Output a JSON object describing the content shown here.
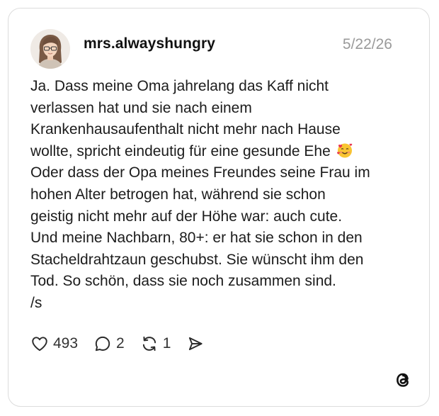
{
  "post": {
    "username": "mrs.alwayshungry",
    "date": "5/22/26",
    "text_before_emoji": "Ja. Dass meine Oma jahrelang das Kaff nicht\nverlassen hat und sie nach einem\nKrankenhausaufenthalt nicht mehr nach Hause\nwollte, spricht eindeutig für eine gesunde Ehe",
    "text_after_emoji": "\nOder dass der Opa meines Freundes seine Frau im\nhohen Alter betrogen hat, während sie schon\ngeistig nicht mehr auf der Höhe war: auch cute.\nUnd meine Nachbarn, 80+: er hat sie schon in den\nStacheldrahtzaun geschubst. Sie wünscht ihm den\nTod. So schön, dass sie noch zusammen sind.\n/s",
    "emoji": "smiling-face-with-hearts"
  },
  "actions": {
    "likes": "493",
    "replies": "2",
    "reposts": "1"
  },
  "icons": {
    "like": "heart-icon",
    "reply": "speech-bubble-icon",
    "repost": "repost-icon",
    "share": "send-icon",
    "brand": "threads-logo-icon"
  },
  "colors": {
    "text": "#1c1c1c",
    "muted": "#9a9a9a",
    "border": "#dcdcdc"
  }
}
